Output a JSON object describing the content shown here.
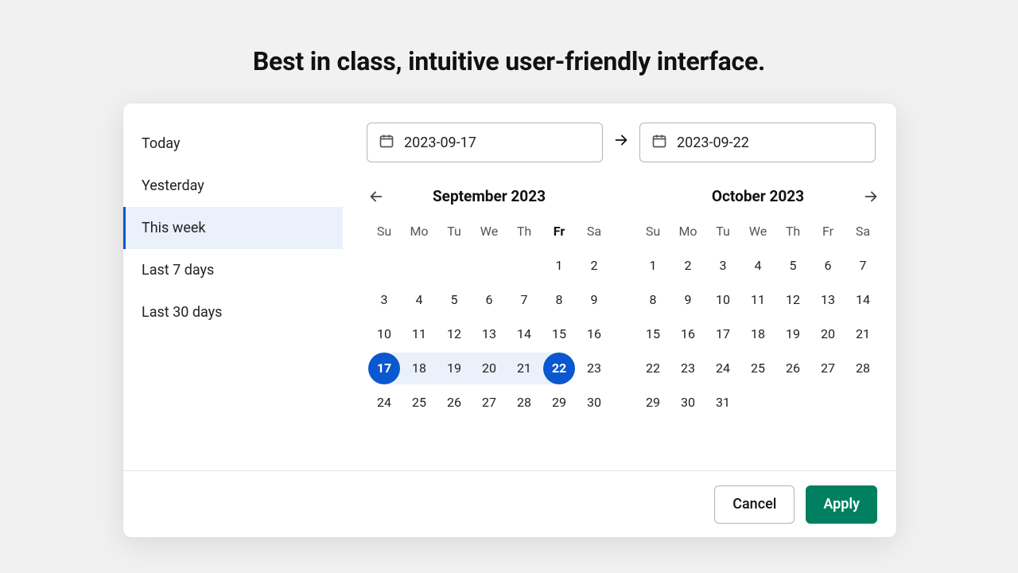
{
  "heading": "Best in class, intuitive user-friendly interface.",
  "presets": [
    {
      "label": "Today",
      "active": false
    },
    {
      "label": "Yesterday",
      "active": false
    },
    {
      "label": "This week",
      "active": true
    },
    {
      "label": "Last 7 days",
      "active": false
    },
    {
      "label": "Last 30 days",
      "active": false
    }
  ],
  "range": {
    "start": "2023-09-17",
    "end": "2023-09-22"
  },
  "dow": [
    "Su",
    "Mo",
    "Tu",
    "We",
    "Th",
    "Fr",
    "Sa"
  ],
  "left": {
    "title": "September 2023",
    "today_col": 5,
    "grid": [
      [
        null,
        null,
        null,
        null,
        null,
        1,
        2
      ],
      [
        3,
        4,
        5,
        6,
        7,
        8,
        9
      ],
      [
        10,
        11,
        12,
        13,
        14,
        15,
        16
      ],
      [
        17,
        18,
        19,
        20,
        21,
        22,
        23
      ],
      [
        24,
        25,
        26,
        27,
        28,
        29,
        30
      ]
    ],
    "range_start_day": 17,
    "range_end_day": 22
  },
  "right": {
    "title": "October 2023",
    "today_col": null,
    "grid": [
      [
        1,
        2,
        3,
        4,
        5,
        6,
        7
      ],
      [
        8,
        9,
        10,
        11,
        12,
        13,
        14
      ],
      [
        15,
        16,
        17,
        18,
        19,
        20,
        21
      ],
      [
        22,
        23,
        24,
        25,
        26,
        27,
        28
      ],
      [
        29,
        30,
        31,
        null,
        null,
        null,
        null
      ]
    ],
    "range_start_day": null,
    "range_end_day": null
  },
  "buttons": {
    "cancel": "Cancel",
    "apply": "Apply"
  }
}
